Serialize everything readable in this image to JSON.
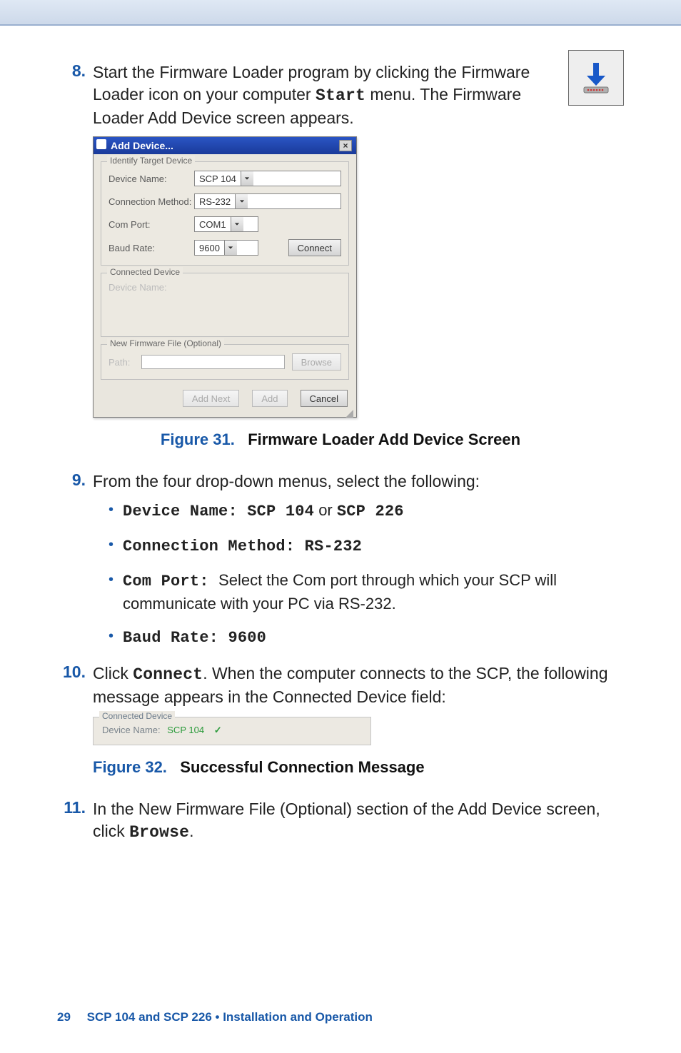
{
  "step8": {
    "num": "8.",
    "text_before": "Start the Firmware Loader program by clicking the Firmware Loader icon on your computer ",
    "start_label": "Start",
    "text_after": " menu. The Firmware Loader Add Device screen appears."
  },
  "addDevice": {
    "title": "Add Device...",
    "close": "×",
    "groups": {
      "identify": {
        "legend": "Identify Target Device",
        "deviceNameLabel": "Device Name:",
        "deviceNameValue": "SCP 104",
        "connMethodLabel": "Connection Method:",
        "connMethodValue": "RS-232",
        "comPortLabel": "Com Port:",
        "comPortValue": "COM1",
        "baudLabel": "Baud Rate:",
        "baudValue": "9600",
        "connectBtn": "Connect"
      },
      "connected": {
        "legend": "Connected Device",
        "deviceNameLabel": "Device Name:"
      },
      "newfw": {
        "legend": "New Firmware File (Optional)",
        "pathLabel": "Path:",
        "browseBtn": "Browse"
      }
    },
    "buttons": {
      "addNext": "Add Next",
      "add": "Add",
      "cancel": "Cancel"
    }
  },
  "fig31": {
    "label": "Figure 31.",
    "text": "Firmware Loader Add Device Screen"
  },
  "step9": {
    "num": "9.",
    "intro": "From the four drop-down menus, select the following:",
    "bullets": {
      "b1": {
        "k": "Device Name",
        "colon": ": ",
        "v1": "SCP 104",
        "mid": " or ",
        "v2": "SCP 226"
      },
      "b2": {
        "k": "Connection Method",
        "colon": ": ",
        "v": "RS-232"
      },
      "b3": {
        "k": "Com Port",
        "colon": ": ",
        "rest": "Select the Com port through which your SCP will communicate with your PC via RS-232."
      },
      "b4": {
        "k": "Baud Rate",
        "colon": ": ",
        "v": "9600"
      }
    }
  },
  "step10": {
    "num": "10.",
    "t1": "Click ",
    "connect": "Connect",
    "t2": ". When the computer connects to the SCP, the following message appears in the Connected Device field:"
  },
  "strip": {
    "legend": "Connected Device",
    "nameLabel": "Device Name:",
    "nameValue": "SCP 104",
    "check": "✓"
  },
  "fig32": {
    "label": "Figure 32.",
    "text": "Successful Connection Message"
  },
  "step11": {
    "num": "11.",
    "t1": "In the New Firmware File (Optional) section of the Add Device screen, click ",
    "browse": "Browse",
    "t2": "."
  },
  "footer": {
    "page": "29",
    "doc": "SCP 104 and SCP 226 • Installation and Operation"
  }
}
